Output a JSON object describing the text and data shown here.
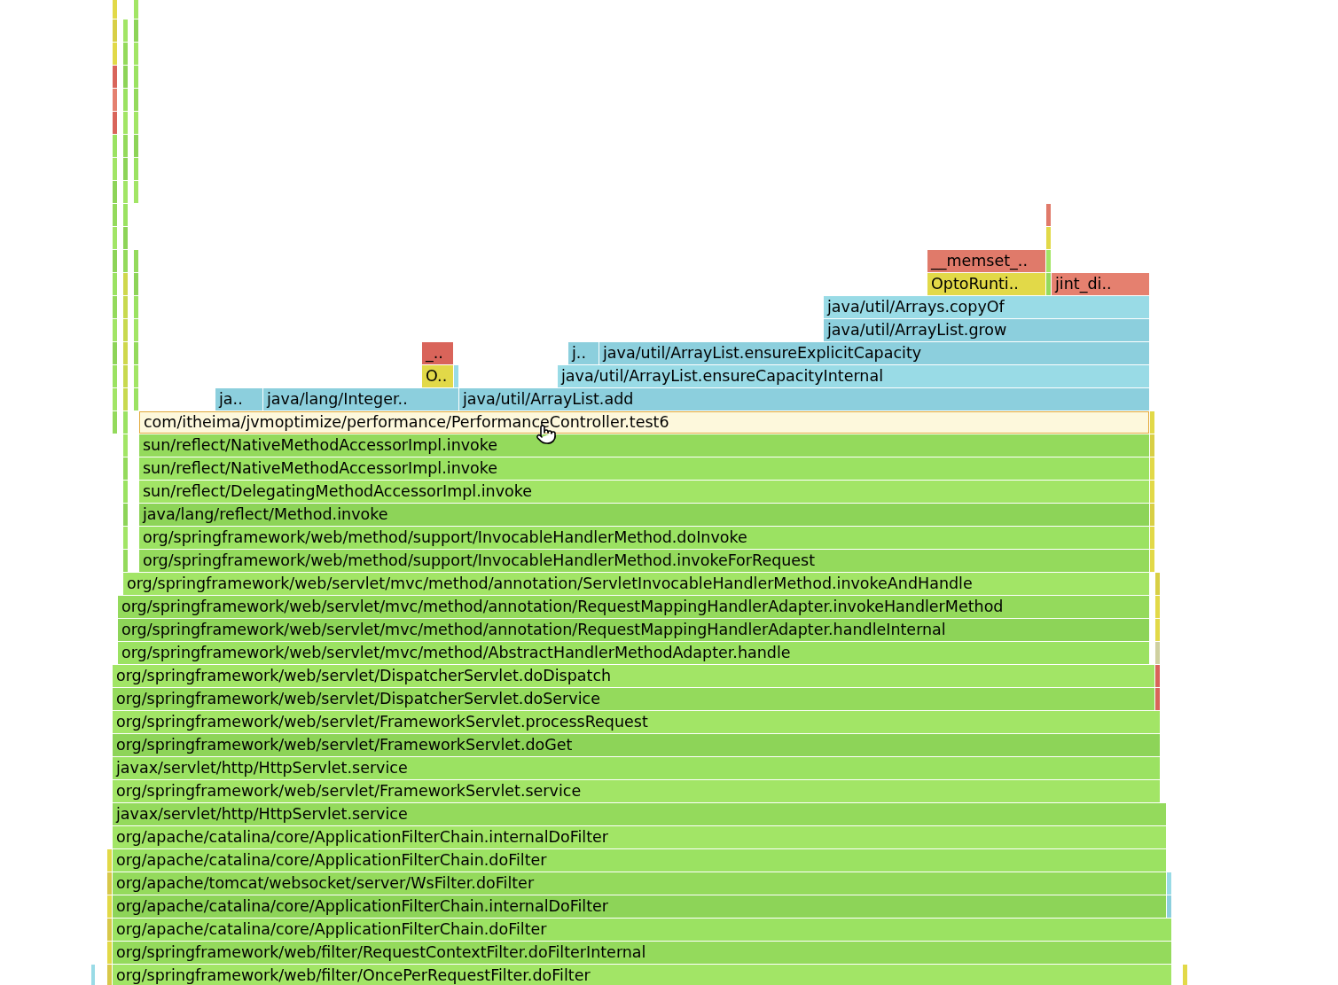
{
  "frames": [
    {
      "color": "#e07a6a",
      "hovered": false
    },
    {
      "color": "#e2d948",
      "hovered": false
    },
    {
      "label": "__memset_..",
      "color": "#e07a6a",
      "hovered": false
    },
    {
      "color": "#a2e566",
      "hovered": false
    },
    {
      "label": "OptoRunti..",
      "color": "#e2d948",
      "hovered": false
    },
    {
      "color": "#94da5c",
      "hovered": false
    },
    {
      "label": "jint_di..",
      "color": "#e5806f",
      "hovered": false
    },
    {
      "label": "java/util/Arrays.copyOf",
      "color": "#99dbe6",
      "hovered": false
    },
    {
      "label": "java/util/ArrayList.grow",
      "color": "#8ccfdd",
      "hovered": false
    },
    {
      "label": "_..",
      "color": "#d9645a",
      "hovered": false
    },
    {
      "label": "j..",
      "color": "#8ccfdd",
      "hovered": false
    },
    {
      "label": "java/util/ArrayList.ensureExplicitCapacity",
      "color": "#8ccfdd",
      "hovered": false
    },
    {
      "label": "O..",
      "color": "#e2d948",
      "hovered": false
    },
    {
      "color": "#99dbe6",
      "hovered": false
    },
    {
      "label": "java/util/ArrayList.ensureCapacityInternal",
      "color": "#99dbe6",
      "hovered": false
    },
    {
      "label": "ja..",
      "color": "#8ccfdd",
      "hovered": false
    },
    {
      "label": "java/lang/Integer..",
      "color": "#8ccfdd",
      "hovered": false
    },
    {
      "label": "java/util/ArrayList.add",
      "color": "#8ccfdd",
      "hovered": false
    },
    {
      "label": "com/itheima/jvmoptimize/performance/PerformanceController.test6",
      "color": "#fdf8dc",
      "hovered": true
    },
    {
      "label": "sun/reflect/NativeMethodAccessorImpl.invoke",
      "color": "#94da5c",
      "hovered": false
    },
    {
      "label": "sun/reflect/NativeMethodAccessorImpl.invoke",
      "color": "#9be262",
      "hovered": false
    },
    {
      "label": "sun/reflect/DelegatingMethodAccessorImpl.invoke",
      "color": "#a2e566",
      "hovered": false
    },
    {
      "label": "java/lang/reflect/Method.invoke",
      "color": "#8dd458",
      "hovered": false
    },
    {
      "label": "org/springframework/web/method/support/InvocableHandlerMethod.doInvoke",
      "color": "#9be262",
      "hovered": false
    },
    {
      "label": "org/springframework/web/method/support/InvocableHandlerMethod.invokeForRequest",
      "color": "#94da5c",
      "hovered": false
    },
    {
      "label": "org/springframework/web/servlet/mvc/method/annotation/ServletInvocableHandlerMethod.invokeAndHandle",
      "color": "#a2e566",
      "hovered": false
    },
    {
      "label": "org/springframework/web/servlet/mvc/method/annotation/RequestMappingHandlerAdapter.invokeHandlerMethod",
      "color": "#94da5c",
      "hovered": false
    },
    {
      "label": "org/springframework/web/servlet/mvc/method/annotation/RequestMappingHandlerAdapter.handleInternal",
      "color": "#8dd458",
      "hovered": false
    },
    {
      "label": "org/springframework/web/servlet/mvc/method/AbstractHandlerMethodAdapter.handle",
      "color": "#9be262",
      "hovered": false
    },
    {
      "label": "org/springframework/web/servlet/DispatcherServlet.doDispatch",
      "color": "#a2e566",
      "hovered": false
    },
    {
      "label": "org/springframework/web/servlet/DispatcherServlet.doService",
      "color": "#94da5c",
      "hovered": false
    },
    {
      "label": "org/springframework/web/servlet/FrameworkServlet.processRequest",
      "color": "#a2e566",
      "hovered": false
    },
    {
      "label": "org/springframework/web/servlet/FrameworkServlet.doGet",
      "color": "#8dd458",
      "hovered": false
    },
    {
      "label": "javax/servlet/http/HttpServlet.service",
      "color": "#9be262",
      "hovered": false
    },
    {
      "label": "org/springframework/web/servlet/FrameworkServlet.service",
      "color": "#a2e566",
      "hovered": false
    },
    {
      "label": "javax/servlet/http/HttpServlet.service",
      "color": "#94da5c",
      "hovered": false
    },
    {
      "label": "org/apache/catalina/core/ApplicationFilterChain.internalDoFilter",
      "color": "#a2e566",
      "hovered": false
    },
    {
      "label": "org/apache/catalina/core/ApplicationFilterChain.doFilter",
      "color": "#9be262",
      "hovered": false
    },
    {
      "label": "org/apache/tomcat/websocket/server/WsFilter.doFilter",
      "color": "#94da5c",
      "hovered": false
    },
    {
      "label": "org/apache/catalina/core/ApplicationFilterChain.internalDoFilter",
      "color": "#8dd458",
      "hovered": false
    },
    {
      "label": "org/apache/catalina/core/ApplicationFilterChain.doFilter",
      "color": "#9be262",
      "hovered": false
    },
    {
      "label": "org/springframework/web/filter/RequestContextFilter.doFilterInternal",
      "color": "#94da5c",
      "hovered": false
    },
    {
      "label": "org/springframework/web/filter/OncePerRequestFilter.doFilter",
      "color": "#a2e566",
      "hovered": false
    }
  ],
  "towers": [
    {
      "segments": [
        {
          "color": "#94da5c"
        },
        {
          "color": "#a2e566"
        },
        {
          "color": "#9be262"
        },
        {
          "color": "#8dd458"
        },
        {
          "color": "#a2e566"
        },
        {
          "color": "#94da5c"
        },
        {
          "color": "#9be262"
        },
        {
          "color": "#8dd458"
        },
        {
          "color": "#a2e566"
        },
        {
          "color": "#94da5c"
        },
        {
          "color": "#8dd458"
        },
        {
          "color": "#a2e566"
        },
        {
          "color": "#9be262"
        },
        {
          "color": "#d9645a"
        },
        {
          "color": "#e5806f"
        },
        {
          "color": "#d9645a"
        },
        {
          "color": "#e2d948"
        },
        {
          "color": "#d8cf45"
        },
        {
          "color": "#e2d948"
        }
      ]
    },
    {
      "segments": [
        {
          "color": "#94da5c"
        },
        {
          "color": "#a2e566"
        },
        {
          "color": "#8dd458"
        },
        {
          "color": "#9be262"
        },
        {
          "color": "#94da5c"
        },
        {
          "color": "#a2e566"
        },
        {
          "color": "#9be262"
        },
        {
          "color": "#c8d94f"
        },
        {
          "color": "#c8d94f"
        },
        {
          "color": "#cfd84c"
        },
        {
          "color": "#c8d94f"
        },
        {
          "color": "#c8d94f"
        },
        {
          "color": "#cfd84c"
        },
        {
          "color": "#94da5c"
        },
        {
          "color": "#8dd458"
        },
        {
          "color": "#9be262"
        },
        {
          "color": "#a2e566"
        },
        {
          "color": "#8dd458"
        },
        {
          "color": "#94da5c"
        },
        {
          "color": "#a2e566"
        },
        {
          "color": "#9be262"
        },
        {
          "color": "#8dd458"
        },
        {
          "color": "#94da5c"
        },
        {
          "color": "#a2e566"
        }
      ]
    },
    {
      "segments": [
        {
          "color": "#9be262"
        },
        {
          "color": "#a2e566"
        },
        {
          "color": "#94da5c"
        },
        {
          "color": "#a2e566"
        },
        {
          "color": "#9be262"
        },
        {
          "color": "#8dd458"
        },
        {
          "color": "#94da5c"
        }
      ]
    },
    {
      "segments": [
        {
          "color": "#a2e566"
        },
        {
          "color": "#9be262"
        },
        {
          "color": "#8dd458"
        },
        {
          "color": "#a2e566"
        },
        {
          "color": "#94da5c"
        },
        {
          "color": "#9be262"
        },
        {
          "color": "#a2e566"
        },
        {
          "color": "#8dd458"
        },
        {
          "color": "#a2e566"
        }
      ]
    },
    {
      "segments": [
        {
          "color": "#e2d948"
        },
        {
          "color": "#e2d948"
        },
        {
          "color": "#d8cf45"
        },
        {
          "color": "#e2d948"
        },
        {
          "color": "#e2d948"
        },
        {
          "color": "#d8cf45"
        },
        {
          "color": "#e2d948"
        }
      ]
    },
    {
      "segments": [
        {
          "color": "#d9645a"
        },
        {
          "color": "#d9645a"
        },
        {
          "color": "#cfd0a0"
        },
        {
          "color": "#e2d948"
        },
        {
          "color": "#e2d948"
        },
        {
          "color": "#d8cf45"
        }
      ]
    },
    {
      "segments": [
        {
          "color": "#d8c84a"
        },
        {
          "color": "#e2d948"
        },
        {
          "color": "#d8c84a"
        },
        {
          "color": "#e2d948"
        },
        {
          "color": "#d8c84a"
        },
        {
          "color": "#e2d948"
        }
      ]
    },
    {
      "segments": [
        {
          "color": "#8ccfdd"
        },
        {
          "color": "#99dbe6"
        }
      ]
    },
    {
      "segments": [
        {
          "color": "#99dbe6"
        }
      ]
    },
    {
      "segments": [
        {
          "color": "#e2d948"
        }
      ]
    }
  ]
}
